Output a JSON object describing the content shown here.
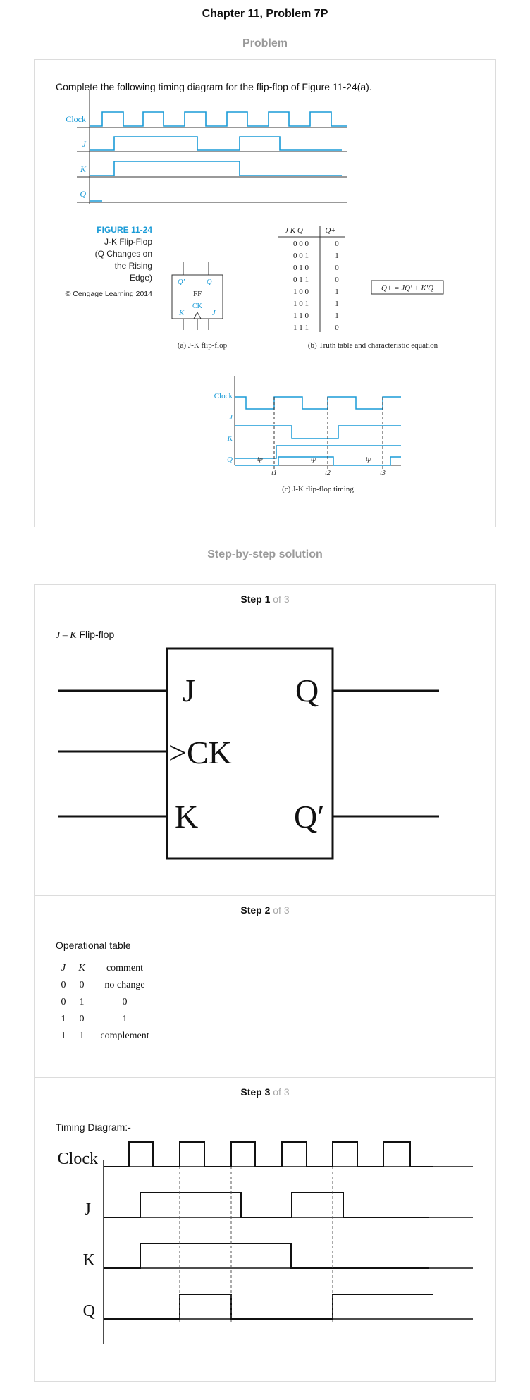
{
  "page_title": "Chapter 11, Problem 7P",
  "problem_heading": "Problem",
  "problem": {
    "text": "Complete the following timing diagram for the flip-flop of Figure 11-24(a).",
    "timing_labels": [
      "Clock",
      "J",
      "K",
      "Q"
    ],
    "figure": {
      "title": "FIGURE 11-24",
      "subtitle_lines": [
        "J-K Flip-Flop",
        "(Q Changes on",
        "the Rising",
        "Edge)"
      ],
      "copyright": "© Cengage Learning 2014",
      "ff_labels": {
        "qbar": "Q'",
        "q": "Q",
        "center": "FF",
        "ck": "CK",
        "k": "K",
        "j": "J"
      },
      "caption_a": "(a) J-K flip-flop",
      "truth_header_left": "J K Q",
      "truth_header_right": "Q+",
      "truth_inputs": [
        "0 0 0",
        "0 0 1",
        "0 1 0",
        "0 1 1",
        "1 0 0",
        "1 0 1",
        "1 1 0",
        "1 1 1"
      ],
      "truth_outputs": [
        "0",
        "1",
        "0",
        "0",
        "1",
        "1",
        "1",
        "0"
      ],
      "equation": "Q+ = JQ' + K'Q",
      "caption_b": "(b) Truth table and characteristic equation",
      "timing_c_labels": [
        "Clock",
        "J",
        "K",
        "Q"
      ],
      "tp_label": "tp",
      "t_labels": [
        "t1",
        "t2",
        "t3"
      ],
      "caption_c": "(c) J-K flip-flop timing"
    }
  },
  "solution_heading": "Step-by-step solution",
  "steps": [
    {
      "label_strong": "Step 1",
      "label_muted": " of 3",
      "intro_italic": "J – K",
      "intro_text": " Flip-flop",
      "block": {
        "j": "J",
        "q": "Q",
        "ck": ">CK",
        "k": "K",
        "qbar": "Q′"
      }
    },
    {
      "label_strong": "Step 2",
      "label_muted": " of 3",
      "intro_text": "Operational table",
      "table_headers": [
        "J",
        "K",
        "comment"
      ],
      "table_rows": [
        [
          "0",
          "0",
          "no change"
        ],
        [
          "0",
          "1",
          "0"
        ],
        [
          "1",
          "0",
          "1"
        ],
        [
          "1",
          "1",
          "complement"
        ]
      ]
    },
    {
      "label_strong": "Step 3",
      "label_muted": " of 3",
      "intro_text": "Timing Diagram:-",
      "signal_labels": [
        "Clock",
        "J",
        "K",
        "Q"
      ]
    }
  ],
  "colors": {
    "figure_blue": "#1a9bd7",
    "heading_gray": "#9a9a9a",
    "border": "#dcdcdc"
  }
}
